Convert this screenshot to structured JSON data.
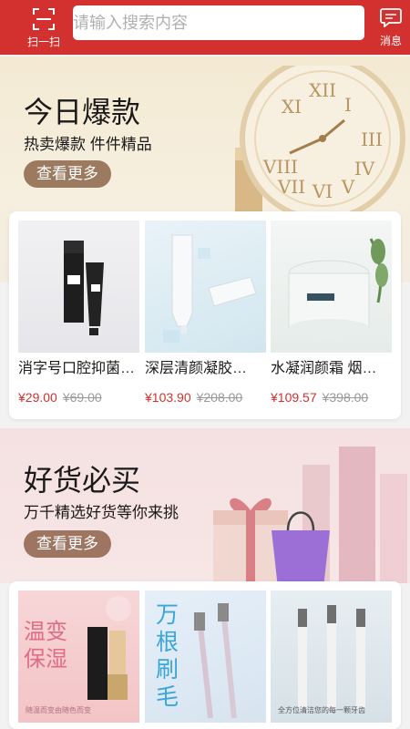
{
  "header": {
    "scan_label": "扫一扫",
    "search_placeholder": "请输入搜索内容",
    "message_label": "消息",
    "accent_color": "#d2312f"
  },
  "banner1": {
    "title": "今日爆款",
    "subtitle": "热卖爆款 件件精品",
    "button_label": "查看更多"
  },
  "products1": [
    {
      "name": "消字号口腔抑菌…",
      "price": "¥29.00",
      "original_price": "¥69.00",
      "image": "toothpaste-tube-image"
    },
    {
      "name": "深层清颜凝胶…",
      "price": "¥103.90",
      "original_price": "¥208.00",
      "image": "cleanser-tube-image"
    },
    {
      "name": "水凝润颜霜 烟…",
      "price": "¥109.57",
      "original_price": "¥398.00",
      "image": "cream-jar-image"
    }
  ],
  "banner2": {
    "title": "好货必买",
    "subtitle": "万千精选好货等你来挑",
    "button_label": "查看更多"
  },
  "products2": [
    {
      "image": "lipstick-image",
      "overlay_text": "温变保湿",
      "caption": "随温而变由随色而变"
    },
    {
      "image": "toothbrush-image",
      "overlay_text": "万根刷毛",
      "caption": ""
    },
    {
      "image": "toothbrush-set-image",
      "overlay_text": "",
      "caption": "全方位清洁您的每一颗牙齿"
    }
  ]
}
